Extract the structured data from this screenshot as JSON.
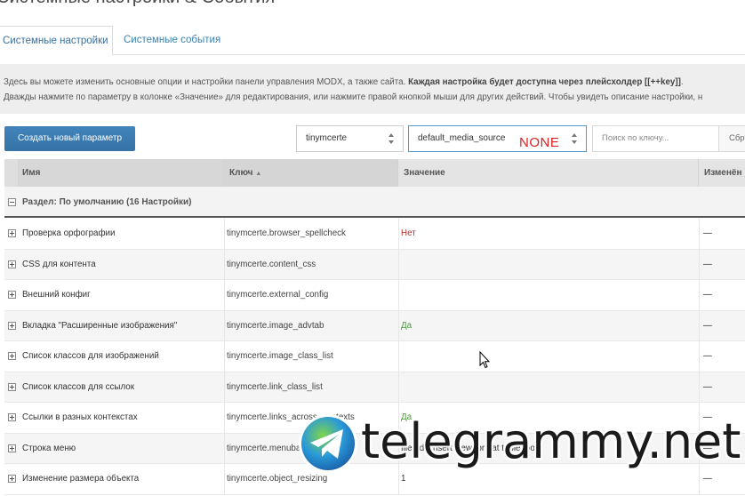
{
  "page": {
    "title": "Системные настройки & События"
  },
  "tabs": [
    {
      "label": "Системные настройки",
      "active": true
    },
    {
      "label": "Системные события",
      "active": false
    }
  ],
  "description": {
    "line1_plain": "Здесь вы можете изменить основные опции и настройки панели управления MODX, а также сайта. ",
    "line1_bold": "Каждая настройка будет доступна через плейсхолдер [[++key]]",
    "line1_end": ".",
    "line2": "Дважды нажмите по параметру в колонке «Значение» для редактирования, или нажмите правой кнопкой мыши для других действий. Чтобы увидеть описание настройки, н"
  },
  "toolbar": {
    "create_label": "Создать новый параметр",
    "namespace_value": "tinymcerte",
    "area_value": "default_media_source",
    "overlay_note": "NONE",
    "search_placeholder": "Поиск по ключу...",
    "reset_label": "Сбр"
  },
  "grid": {
    "columns": {
      "name": "Имя",
      "key": "Ключ",
      "key_sort": "▲",
      "value": "Значение",
      "edited": "Изменён"
    },
    "group_label": "Раздел: По умолчанию (16 Настройки)",
    "rows": [
      {
        "name": "Проверка орфографии",
        "key": "tinymcerte.browser_spellcheck",
        "value": "Нет",
        "value_type": "no",
        "edited": "—"
      },
      {
        "name": "CSS для контента",
        "key": "tinymcerte.content_css",
        "value": "",
        "value_type": "plain",
        "edited": "—"
      },
      {
        "name": "Внешний конфиг",
        "key": "tinymcerte.external_config",
        "value": "",
        "value_type": "plain",
        "edited": "—"
      },
      {
        "name": "Вкладка \"Расширенные изображения\"",
        "key": "tinymcerte.image_advtab",
        "value": "Да",
        "value_type": "yes",
        "edited": "—"
      },
      {
        "name": "Список классов для изображений",
        "key": "tinymcerte.image_class_list",
        "value": "",
        "value_type": "plain",
        "edited": "—"
      },
      {
        "name": "Список классов для ссылок",
        "key": "tinymcerte.link_class_list",
        "value": "",
        "value_type": "plain",
        "edited": "—"
      },
      {
        "name": "Ссылки в разных контекстах",
        "key": "tinymcerte.links_across_contexts",
        "value": "Да",
        "value_type": "yes",
        "edited": "—"
      },
      {
        "name": "Строка меню",
        "key": "tinymcerte.menubar",
        "value": "file edit insert view format table tools",
        "value_type": "plain",
        "edited": "—"
      },
      {
        "name": "Изменение размера объекта",
        "key": "tinymcerte.object_resizing",
        "value": "1",
        "value_type": "plain",
        "edited": "—"
      }
    ]
  },
  "watermark": {
    "text": "telegrammy.net"
  },
  "colors": {
    "accent": "#3d82ae",
    "button": "#3a7cb0",
    "no": "#b03030",
    "yes": "#4a9a3a",
    "note": "#e02020"
  }
}
